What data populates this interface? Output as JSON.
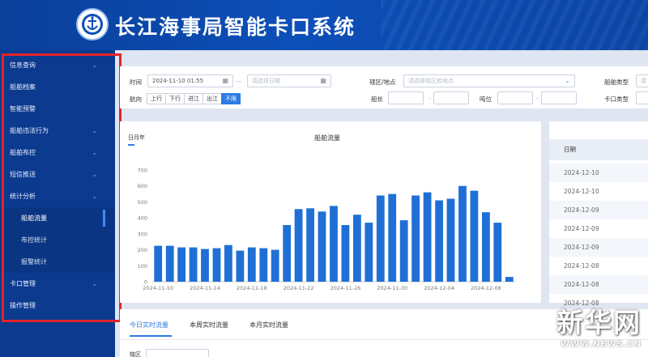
{
  "header": {
    "title": "长江海事局智能卡口系统",
    "logo_icon": "maritime-anchor-emblem-icon"
  },
  "sidebar": {
    "items": [
      {
        "label": "信息查询",
        "has_chevron": true
      },
      {
        "label": "船舶档案",
        "has_chevron": false
      },
      {
        "label": "智能预警",
        "has_chevron": false
      },
      {
        "label": "船舶违法行为",
        "has_chevron": true
      },
      {
        "label": "船舶布控",
        "has_chevron": true
      },
      {
        "label": "短信推送",
        "has_chevron": true
      },
      {
        "label": "统计分析",
        "has_chevron": true
      },
      {
        "label": "船舶流量",
        "sub": true,
        "active": true
      },
      {
        "label": "布控统计",
        "sub": true
      },
      {
        "label": "报警统计",
        "sub": true
      },
      {
        "label": "卡口管理",
        "has_chevron": true
      },
      {
        "label": "操作管理",
        "has_chevron": false
      }
    ],
    "highlight_color": "#e3242b"
  },
  "filters": {
    "time_label": "时间",
    "time_start": "2024-11-10 01:55",
    "time_end_placeholder": "请选择日期",
    "time_sep": "—",
    "area_label": "辖区/地点",
    "area_placeholder": "请选择辖区和地点",
    "ship_type_label": "船舶类型",
    "ship_type_placeholder": "请",
    "direction_label": "航向",
    "directions": [
      "上行",
      "下行",
      "进江",
      "出江",
      "不限"
    ],
    "direction_selected": "不限",
    "length_label": "船长",
    "draft_label": "吨位",
    "range_sep": "-",
    "checkpoint_type_label": "卡口类型"
  },
  "chart_panel": {
    "tab": "日月年",
    "title": "船舶流量"
  },
  "chart_data": {
    "type": "bar",
    "title": "船舶流量",
    "xlabel": "",
    "ylabel": "",
    "ylim": [
      0,
      700
    ],
    "yticks": [
      0,
      100,
      200,
      300,
      400,
      500,
      600,
      700
    ],
    "x_tick_labels": [
      "2024-11-10",
      "2024-11-14",
      "2024-11-18",
      "2024-11-22",
      "2024-11-26",
      "2024-11-30",
      "2024-12-04",
      "2024-12-08"
    ],
    "categories": [
      "2024-11-10",
      "2024-11-11",
      "2024-11-12",
      "2024-11-13",
      "2024-11-14",
      "2024-11-15",
      "2024-11-16",
      "2024-11-17",
      "2024-11-18",
      "2024-11-19",
      "2024-11-20",
      "2024-11-21",
      "2024-11-22",
      "2024-11-23",
      "2024-11-24",
      "2024-11-25",
      "2024-11-26",
      "2024-11-27",
      "2024-11-28",
      "2024-11-29",
      "2024-11-30",
      "2024-12-01",
      "2024-12-02",
      "2024-12-03",
      "2024-12-04",
      "2024-12-05",
      "2024-12-06",
      "2024-12-07",
      "2024-12-08",
      "2024-12-09"
    ],
    "values": [
      225,
      225,
      215,
      215,
      205,
      210,
      230,
      195,
      215,
      210,
      200,
      355,
      455,
      460,
      440,
      475,
      355,
      420,
      370,
      540,
      550,
      385,
      540,
      560,
      510,
      520,
      600,
      570,
      435,
      370,
      30
    ],
    "bar_color": "#1f6fd6"
  },
  "table": {
    "header": "日期",
    "rows": [
      "2024-12-10",
      "2024-12-10",
      "2024-12-09",
      "2024-12-09",
      "2024-12-09",
      "2024-12-08",
      "2024-12-08",
      "2024-12-08"
    ]
  },
  "bottom": {
    "tabs": [
      "今日实时流量",
      "本周实时流量",
      "本月实时流量"
    ],
    "active_tab": "今日实时流量",
    "field_label": "辖区"
  },
  "watermark": {
    "main": "新华网",
    "sub": "WWW.NEWS.CN"
  }
}
